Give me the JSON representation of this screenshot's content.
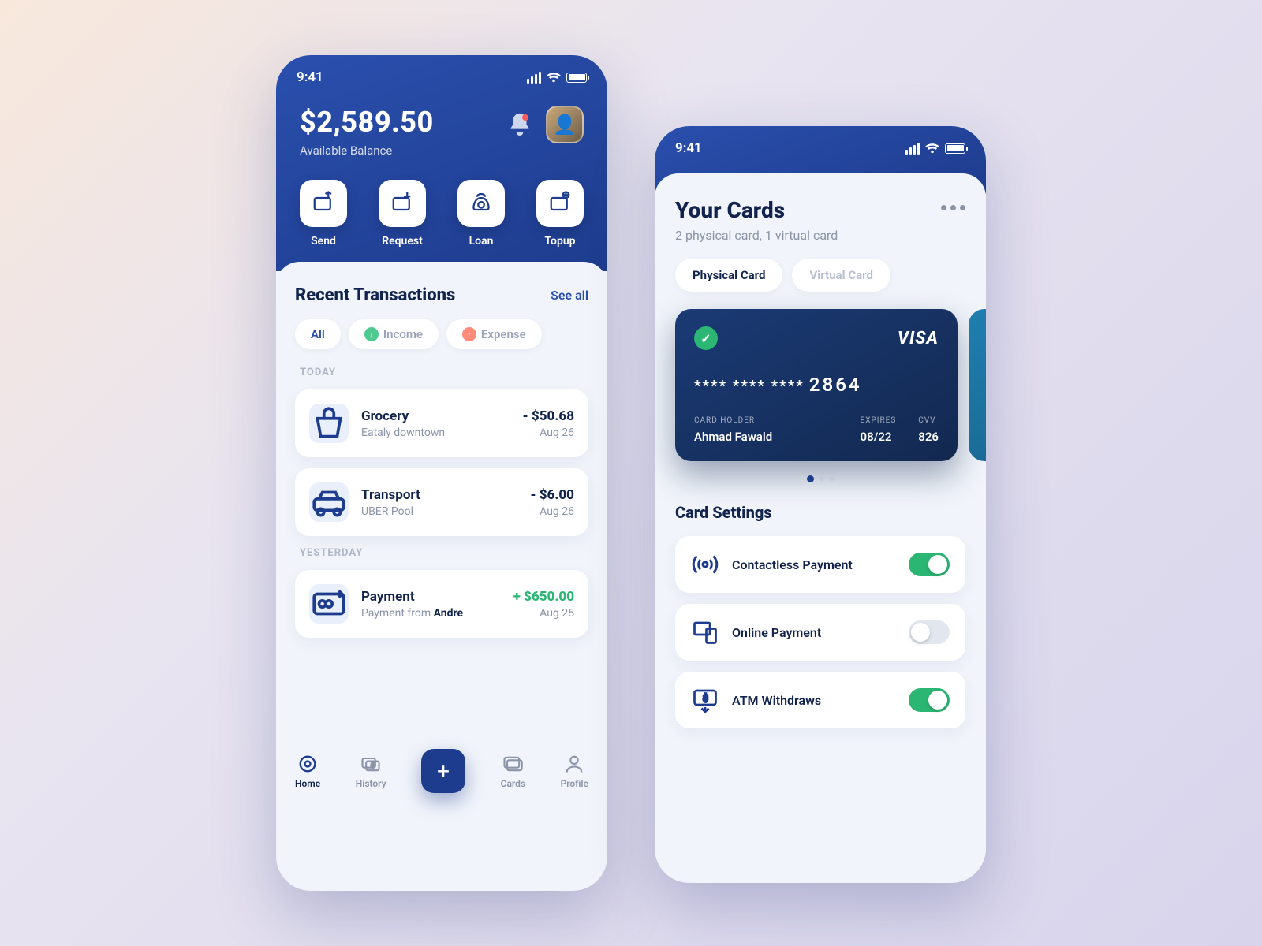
{
  "statusbar": {
    "time": "9:41"
  },
  "home": {
    "balance_amount": "$2,589.50",
    "balance_label": "Available Balance",
    "actions": [
      {
        "label": "Send"
      },
      {
        "label": "Request"
      },
      {
        "label": "Loan"
      },
      {
        "label": "Topup"
      }
    ],
    "recent_title": "Recent Transactions",
    "see_all": "See all",
    "filters": {
      "all": "All",
      "income": "Income",
      "expense": "Expense"
    },
    "groups": {
      "today_label": "TODAY",
      "yesterday_label": "YESTERDAY"
    },
    "transactions": {
      "today": [
        {
          "title": "Grocery",
          "subtitle": "Eataly downtown",
          "amount": "- $50.68",
          "date": "Aug 26",
          "positive": false
        },
        {
          "title": "Transport",
          "subtitle": "UBER Pool",
          "amount": "- $6.00",
          "date": "Aug 26",
          "positive": false
        }
      ],
      "yesterday": [
        {
          "title": "Payment",
          "subtitle_prefix": "Payment from ",
          "subtitle_bold": "Andre",
          "amount": "+ $650.00",
          "date": "Aug 25",
          "positive": true
        }
      ]
    },
    "tabs": {
      "home": "Home",
      "history": "History",
      "cards": "Cards",
      "profile": "Profile"
    }
  },
  "cards": {
    "title": "Your Cards",
    "subtitle": "2 physical card, 1 virtual card",
    "pills": {
      "physical": "Physical Card",
      "virtual": "Virtual Card"
    },
    "card": {
      "brand": "VISA",
      "masked": "****  ****  ****",
      "last4": "2864",
      "holder_label": "CARD HOLDER",
      "holder": "Ahmad Fawaid",
      "expires_label": "EXPIRES",
      "expires": "08/22",
      "cvv_label": "CVV",
      "cvv": "826"
    },
    "settings_title": "Card Settings",
    "settings": [
      {
        "label": "Contactless Payment",
        "on": true
      },
      {
        "label": "Online Payment",
        "on": false
      },
      {
        "label": "ATM Withdraws",
        "on": true
      }
    ]
  }
}
